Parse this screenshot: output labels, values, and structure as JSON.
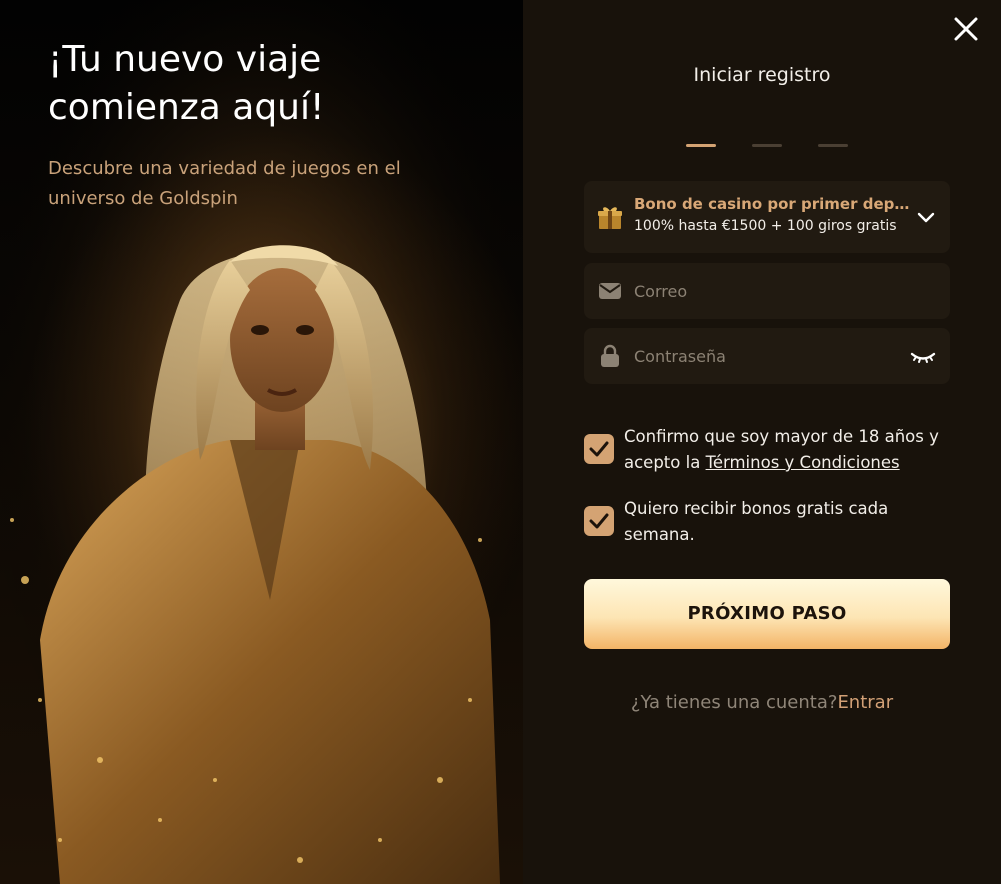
{
  "hero": {
    "headline": "¡Tu nuevo viaje comienza aquí!",
    "subtitle": "Descubre una variedad de juegos en el universo de Goldspin"
  },
  "form": {
    "title": "Iniciar registro",
    "steps": {
      "current": 1,
      "total": 3
    },
    "bonus": {
      "title": "Bono de casino por primer depósito",
      "description": "100% hasta €1500 + 100 giros gratis",
      "icon": "gift-icon"
    },
    "email": {
      "placeholder": "Correo",
      "icon": "envelope-icon"
    },
    "password": {
      "placeholder": "Contraseña",
      "icon": "lock-icon",
      "toggle_icon": "eye-closed-icon"
    },
    "checks": {
      "age": {
        "text": "Confirmo que soy mayor de 18 años y acepto la ",
        "link": "Términos y Condiciones",
        "checked": true
      },
      "bonus": {
        "text": "Quiero recibir bonos gratis cada semana.",
        "checked": true
      }
    },
    "cta": "PRÓXIMO PASO",
    "login_prompt": "¿Ya tienes una cuenta?",
    "login_link": "Entrar"
  },
  "colors": {
    "accent": "#d4a373",
    "panel": "#18120b",
    "field": "#211a11",
    "bonus_title": "#d9a877"
  }
}
